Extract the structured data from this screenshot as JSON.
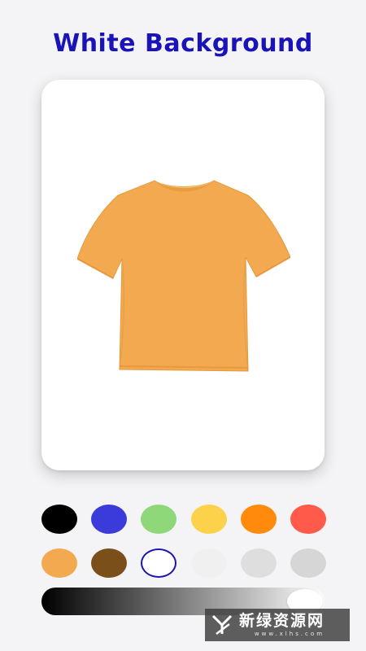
{
  "header": {
    "title": "White Background",
    "title_color": "#1a14b8"
  },
  "preview": {
    "background_color": "#ffffff",
    "shirt_color": "#f2a950",
    "shirt_icon": "tshirt-icon"
  },
  "palette": {
    "rows": [
      [
        "#000000",
        "#3b3bdc",
        "#8fd87a",
        "#fbd24a",
        "#ff8a0c",
        "#ff5a4a"
      ],
      [
        "#f2a950",
        "#7a4f1a",
        "#ffffff",
        "#f0f0f0",
        "#dedede",
        "#d6d6d6"
      ]
    ],
    "selected_color": "#ffffff",
    "selected_ring_color": "#1a14b8"
  },
  "brightness_slider": {
    "gradient_start": "#000000",
    "gradient_end": "#ffffff",
    "value": 1.0
  },
  "watermark": {
    "main_text": "新绿资源网",
    "sub_text": "www.xlhs.com",
    "logo_icon": "xl-logo-icon"
  }
}
